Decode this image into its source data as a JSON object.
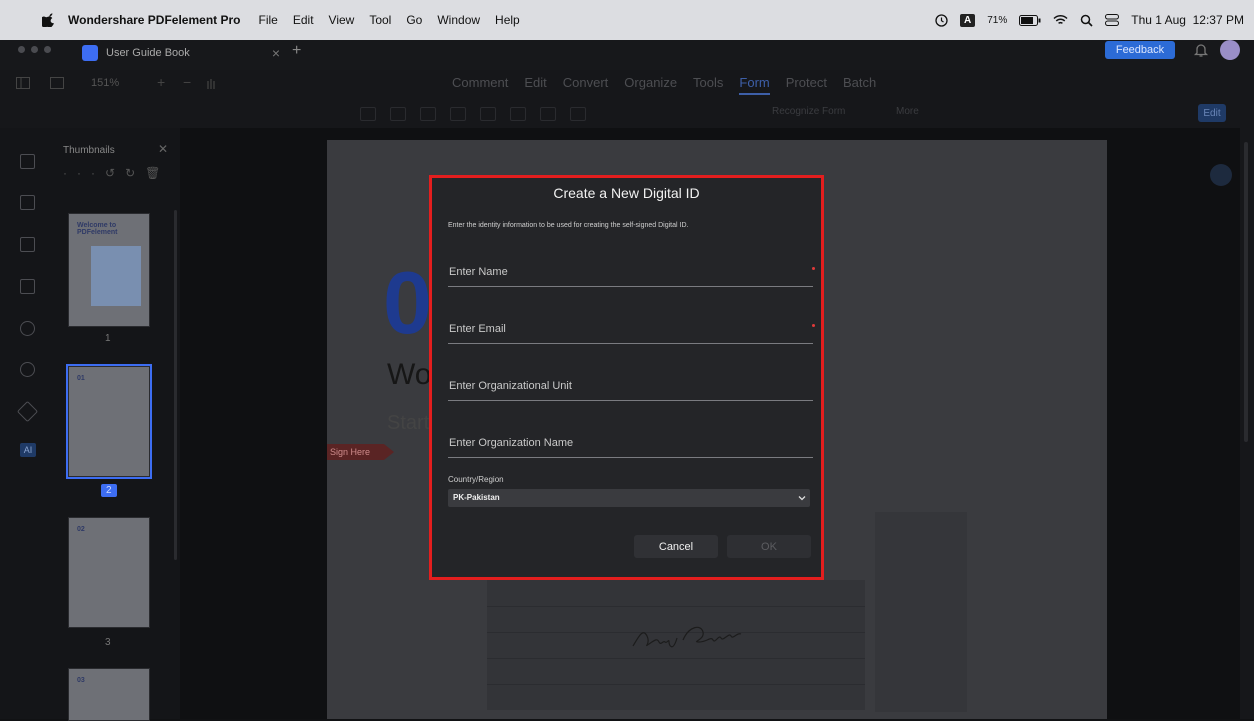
{
  "menubar": {
    "app_name": "Wondershare PDFelement Pro",
    "menus": [
      "File",
      "Edit",
      "View",
      "Tool",
      "Go",
      "Window",
      "Help"
    ],
    "input_badge": "A",
    "battery": "71%",
    "datetime": "Thu 1 Aug  12:37 PM"
  },
  "tabs": {
    "doc_title": "User Guide Book",
    "feedback_label": "Feedback"
  },
  "toolbar": {
    "zoom": "151%",
    "menu_tabs": [
      "Comment",
      "Edit",
      "Convert",
      "Organize",
      "Tools",
      "Form",
      "Protect",
      "Batch"
    ],
    "active_tab": "Form",
    "recognize_form": "Recognize Form",
    "more_label": "More",
    "edit_label": "Edit"
  },
  "thumbnails": {
    "title": "Thumbnails",
    "page_numbers": [
      "1",
      "2",
      "3"
    ],
    "selected_page": "2",
    "thumb_labels": [
      "Welcome to PDFelement",
      "01",
      "02",
      "03"
    ]
  },
  "document": {
    "big_number": "0",
    "heading_fragment": "Wo",
    "subheading_fragment": "Start",
    "sign_here": "Sign Here"
  },
  "dialog": {
    "title": "Create a New Digital ID",
    "description": "Enter the identity information to be used for creating the self-signed Digital ID.",
    "fields": [
      {
        "placeholder": "Enter Name",
        "required": true
      },
      {
        "placeholder": "Enter Email",
        "required": true
      },
      {
        "placeholder": "Enter Organizational Unit",
        "required": false
      },
      {
        "placeholder": "Enter Organization Name",
        "required": false
      }
    ],
    "country_label": "Country/Region",
    "country_value": "PK-Pakistan",
    "cancel_label": "Cancel",
    "ok_label": "OK",
    "highlight_color": "#e31e1e"
  }
}
